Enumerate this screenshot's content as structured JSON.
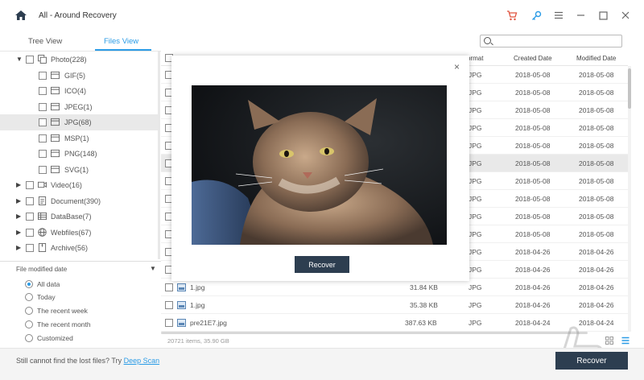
{
  "window": {
    "title": "All - Around Recovery"
  },
  "tabs": {
    "tree_view": "Tree View",
    "files_view": "Files View"
  },
  "tree": [
    {
      "label": "Photo(228)",
      "icon": "photo-icon",
      "expanded": true,
      "depth": 0
    },
    {
      "label": "GIF(5)",
      "icon": "image-file-icon",
      "depth": 1
    },
    {
      "label": "ICO(4)",
      "icon": "image-file-icon",
      "depth": 1
    },
    {
      "label": "JPEG(1)",
      "icon": "image-file-icon",
      "depth": 1
    },
    {
      "label": "JPG(68)",
      "icon": "image-file-icon",
      "depth": 1,
      "selected": true
    },
    {
      "label": "MSP(1)",
      "icon": "image-file-icon",
      "depth": 1
    },
    {
      "label": "PNG(148)",
      "icon": "image-file-icon",
      "depth": 1
    },
    {
      "label": "SVG(1)",
      "icon": "image-file-icon",
      "depth": 1
    },
    {
      "label": "Video(16)",
      "icon": "video-icon",
      "depth": 0
    },
    {
      "label": "Document(390)",
      "icon": "document-icon",
      "depth": 0
    },
    {
      "label": "DataBase(7)",
      "icon": "database-icon",
      "depth": 0
    },
    {
      "label": "Webfiles(67)",
      "icon": "globe-icon",
      "depth": 0
    },
    {
      "label": "Archive(56)",
      "icon": "archive-icon",
      "depth": 0
    }
  ],
  "filter": {
    "title": "File modified date",
    "options": [
      "All data",
      "Today",
      "The recent week",
      "The recent month",
      "Customized"
    ],
    "selected": "All data"
  },
  "table": {
    "headers": {
      "format": "ormat",
      "created": "Created Date",
      "modified": "Modified Date"
    },
    "rows": [
      {
        "name": "",
        "size": "",
        "format": "JPG",
        "created": "2018-05-08",
        "modified": "2018-05-08"
      },
      {
        "name": "",
        "size": "",
        "format": "JPG",
        "created": "2018-05-08",
        "modified": "2018-05-08"
      },
      {
        "name": "",
        "size": "",
        "format": "JPG",
        "created": "2018-05-08",
        "modified": "2018-05-08"
      },
      {
        "name": "",
        "size": "",
        "format": "JPG",
        "created": "2018-05-08",
        "modified": "2018-05-08"
      },
      {
        "name": "",
        "size": "",
        "format": "JPG",
        "created": "2018-05-08",
        "modified": "2018-05-08"
      },
      {
        "name": "",
        "size": "",
        "format": "JPG",
        "created": "2018-05-08",
        "modified": "2018-05-08",
        "selected": true
      },
      {
        "name": "",
        "size": "",
        "format": "JPG",
        "created": "2018-05-08",
        "modified": "2018-05-08"
      },
      {
        "name": "",
        "size": "",
        "format": "JPG",
        "created": "2018-05-08",
        "modified": "2018-05-08"
      },
      {
        "name": "",
        "size": "",
        "format": "JPG",
        "created": "2018-05-08",
        "modified": "2018-05-08"
      },
      {
        "name": "",
        "size": "",
        "format": "JPG",
        "created": "2018-05-08",
        "modified": "2018-05-08"
      },
      {
        "name": "",
        "size": "",
        "format": "JPG",
        "created": "2018-04-26",
        "modified": "2018-04-26"
      },
      {
        "name": "",
        "size": "",
        "format": "JPG",
        "created": "2018-04-26",
        "modified": "2018-04-26"
      },
      {
        "name": "1.jpg",
        "size": "31.84 KB",
        "format": "JPG",
        "created": "2018-04-26",
        "modified": "2018-04-26"
      },
      {
        "name": "1.jpg",
        "size": "35.38 KB",
        "format": "JPG",
        "created": "2018-04-26",
        "modified": "2018-04-26"
      },
      {
        "name": "pre21E7.jpg",
        "size": "387.63 KB",
        "format": "JPG",
        "created": "2018-04-24",
        "modified": "2018-04-24"
      }
    ]
  },
  "status": "20721 items, 35.90 GB",
  "footer": {
    "text": "Still cannot find the lost files? Try ",
    "link": "Deep Scan",
    "recover": "Recover"
  },
  "modal": {
    "recover": "Recover",
    "close": "×"
  },
  "colors": {
    "accent": "#2a9be6",
    "button": "#2d3e50",
    "cart": "#e0533f"
  }
}
